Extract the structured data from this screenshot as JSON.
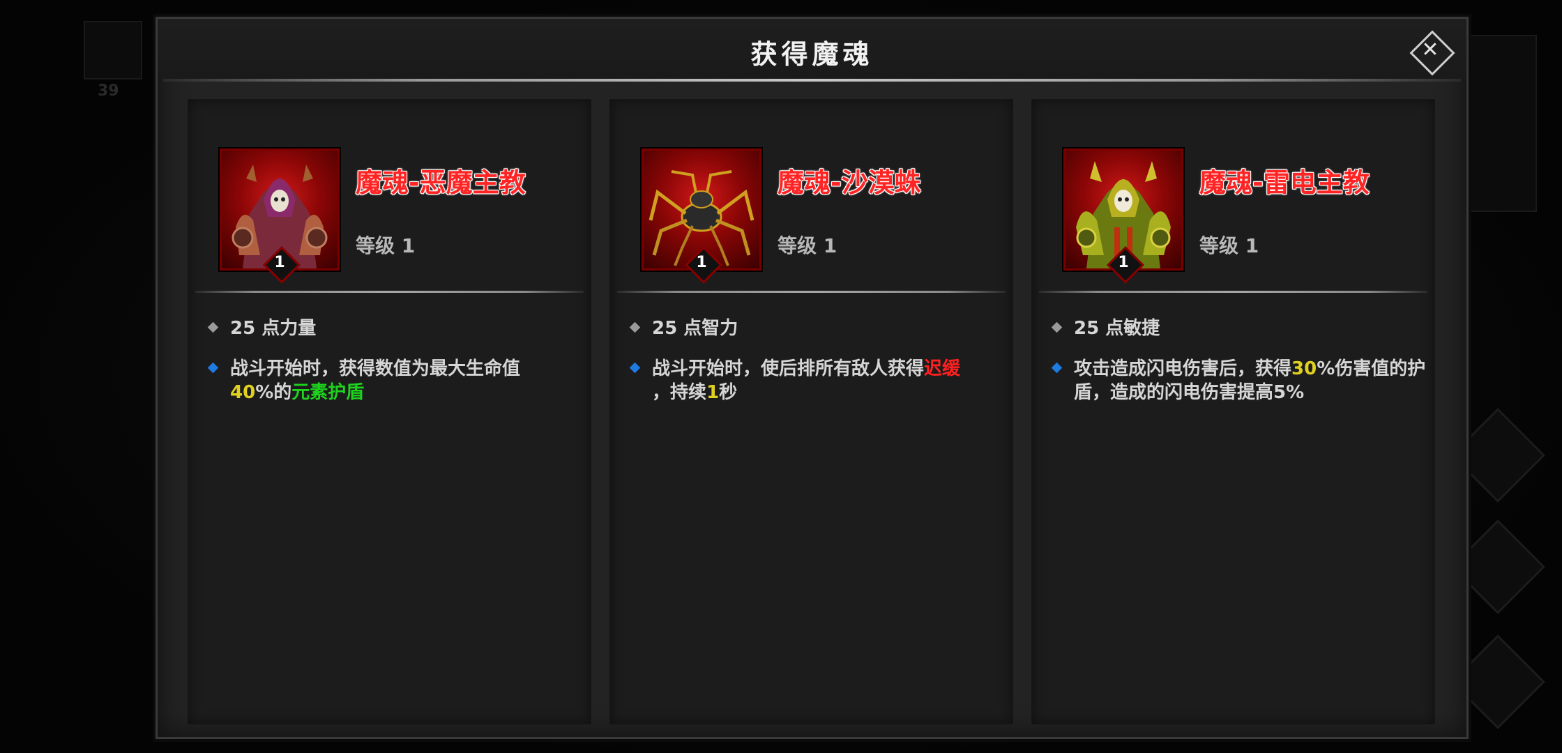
{
  "modal": {
    "title": "获得魔魂",
    "close_icon": "close-icon"
  },
  "background": {
    "ghost_number": "39"
  },
  "cards": [
    {
      "name": "魔魂-恶魔主教",
      "level_text": "等级 1",
      "badge_level": "1",
      "portrait_icon": "demon-bishop-portrait",
      "stat": "25 点力量",
      "effect": {
        "p1": "战斗开始时，获得数值为最大生命值",
        "p2": "40",
        "p3": "%的",
        "p4": "元素护盾"
      }
    },
    {
      "name": "魔魂-沙漠蛛",
      "level_text": "等级 1",
      "badge_level": "1",
      "portrait_icon": "desert-spider-portrait",
      "stat": "25 点智力",
      "effect": {
        "p1": "战斗开始时，使后排所有敌人获得",
        "p2": "迟缓",
        "p3": "，持续",
        "p4": "1",
        "p5": "秒"
      }
    },
    {
      "name": "魔魂-雷电主教",
      "level_text": "等级 1",
      "badge_level": "1",
      "portrait_icon": "thunder-bishop-portrait",
      "stat": "25 点敏捷",
      "effect": {
        "p1": "攻击造成闪电伤害后，获得",
        "p2": "30",
        "p3": "%伤害值的护盾，造成的闪电伤害提高5%"
      }
    }
  ],
  "colors": {
    "name_red": "#ff2424",
    "highlight_yellow": "#e0d020",
    "highlight_green": "#1ed21e",
    "highlight_red": "#ff2020",
    "bullet_blue": "#1e7be0"
  }
}
